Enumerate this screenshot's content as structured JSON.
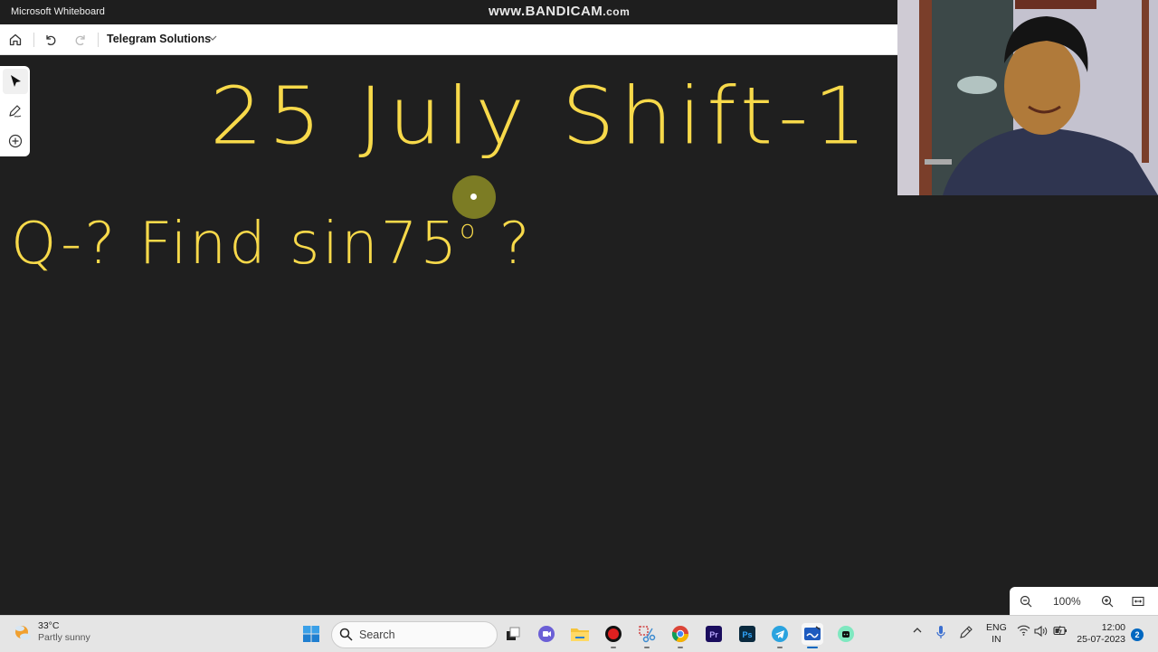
{
  "window": {
    "app_title": "Microsoft Whiteboard",
    "watermark": "www.BANDICAM.com",
    "watermark_main": "www.BANDICAM",
    "watermark_suffix": ".com"
  },
  "toolbar": {
    "home_icon": "home-icon",
    "undo_icon": "undo-icon",
    "redo_icon": "redo-icon",
    "board_name": "Telegram Solutions",
    "dropdown_icon": "chevron-down-icon"
  },
  "side_tools": [
    {
      "name": "select",
      "icon": "cursor-arrow-icon",
      "active": true
    },
    {
      "name": "ink",
      "icon": "pen-icon",
      "active": false
    },
    {
      "name": "add",
      "icon": "plus-circle-icon",
      "active": false
    }
  ],
  "canvas": {
    "ink_color": "#f7d94a",
    "title_ink": "25 July Shift-1",
    "question_ink_prefix": "Q-? Find sin75",
    "question_degree": "o",
    "question_suffix": " ?"
  },
  "zoom_controls": {
    "zoom_out_icon": "zoom-out-icon",
    "zoom_level": "100%",
    "zoom_in_icon": "zoom-in-icon",
    "fit_icon": "fit-to-screen-icon"
  },
  "taskbar": {
    "weather": {
      "temperature": "33°C",
      "condition": "Partly sunny"
    },
    "search_placeholder": "Search",
    "apps": [
      {
        "name": "Task View",
        "icon": "task-view-icon"
      },
      {
        "name": "Teams Chat",
        "icon": "meet-icon"
      },
      {
        "name": "File Explorer",
        "icon": "folder-icon"
      },
      {
        "name": "Bandicam",
        "icon": "record-icon"
      },
      {
        "name": "Snipping Tool",
        "icon": "snipping-tool-icon"
      },
      {
        "name": "Google Chrome",
        "icon": "chrome-icon"
      },
      {
        "name": "Adobe Premiere Pro",
        "icon": "premiere-icon",
        "label": "Pr"
      },
      {
        "name": "Adobe Photoshop",
        "icon": "photoshop-icon",
        "label": "Ps"
      },
      {
        "name": "Telegram",
        "icon": "telegram-icon"
      },
      {
        "name": "Microsoft Whiteboard",
        "icon": "whiteboard-icon"
      },
      {
        "name": "Copilot",
        "icon": "chat-bot-icon"
      }
    ],
    "tray": {
      "language_line1": "ENG",
      "language_line2": "IN",
      "time": "12:00",
      "date": "25-07-2023",
      "notification_count": "2"
    }
  }
}
